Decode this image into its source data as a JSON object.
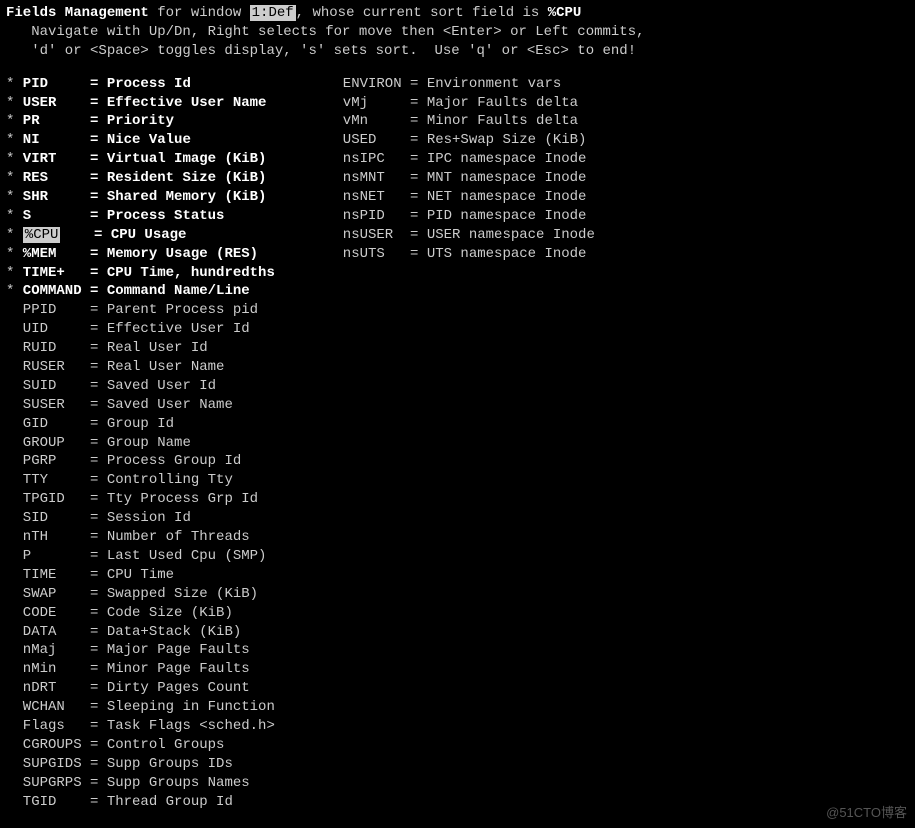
{
  "header": {
    "title": "Fields Management",
    "for_window_label": " for window ",
    "window_name": "1:Def",
    "sort_label": ", whose current sort field is ",
    "sort_field": "%CPU",
    "help1": "Navigate with Up/Dn, Right selects for move then <Enter> or Left commits,",
    "help2": "'d' or <Space> toggles display, 's' sets sort.  Use 'q' or <Esc> to end!"
  },
  "selected": "%CPU",
  "col1": [
    {
      "star": true,
      "name": "PID",
      "desc": "Process Id"
    },
    {
      "star": true,
      "name": "USER",
      "desc": "Effective User Name"
    },
    {
      "star": true,
      "name": "PR",
      "desc": "Priority"
    },
    {
      "star": true,
      "name": "NI",
      "desc": "Nice Value"
    },
    {
      "star": true,
      "name": "VIRT",
      "desc": "Virtual Image (KiB)"
    },
    {
      "star": true,
      "name": "RES",
      "desc": "Resident Size (KiB)"
    },
    {
      "star": true,
      "name": "SHR",
      "desc": "Shared Memory (KiB)"
    },
    {
      "star": true,
      "name": "S",
      "desc": "Process Status"
    },
    {
      "star": true,
      "name": "%CPU",
      "desc": "CPU Usage"
    },
    {
      "star": true,
      "name": "%MEM",
      "desc": "Memory Usage (RES)"
    },
    {
      "star": true,
      "name": "TIME+",
      "desc": "CPU Time, hundredths"
    },
    {
      "star": true,
      "name": "COMMAND",
      "desc": "Command Name/Line"
    },
    {
      "star": false,
      "name": "PPID",
      "desc": "Parent Process pid"
    },
    {
      "star": false,
      "name": "UID",
      "desc": "Effective User Id"
    },
    {
      "star": false,
      "name": "RUID",
      "desc": "Real User Id"
    },
    {
      "star": false,
      "name": "RUSER",
      "desc": "Real User Name"
    },
    {
      "star": false,
      "name": "SUID",
      "desc": "Saved User Id"
    },
    {
      "star": false,
      "name": "SUSER",
      "desc": "Saved User Name"
    },
    {
      "star": false,
      "name": "GID",
      "desc": "Group Id"
    },
    {
      "star": false,
      "name": "GROUP",
      "desc": "Group Name"
    },
    {
      "star": false,
      "name": "PGRP",
      "desc": "Process Group Id"
    },
    {
      "star": false,
      "name": "TTY",
      "desc": "Controlling Tty"
    },
    {
      "star": false,
      "name": "TPGID",
      "desc": "Tty Process Grp Id"
    },
    {
      "star": false,
      "name": "SID",
      "desc": "Session Id"
    },
    {
      "star": false,
      "name": "nTH",
      "desc": "Number of Threads"
    },
    {
      "star": false,
      "name": "P",
      "desc": "Last Used Cpu (SMP)"
    },
    {
      "star": false,
      "name": "TIME",
      "desc": "CPU Time"
    },
    {
      "star": false,
      "name": "SWAP",
      "desc": "Swapped Size (KiB)"
    },
    {
      "star": false,
      "name": "CODE",
      "desc": "Code Size (KiB)"
    },
    {
      "star": false,
      "name": "DATA",
      "desc": "Data+Stack (KiB)"
    },
    {
      "star": false,
      "name": "nMaj",
      "desc": "Major Page Faults"
    },
    {
      "star": false,
      "name": "nMin",
      "desc": "Minor Page Faults"
    },
    {
      "star": false,
      "name": "nDRT",
      "desc": "Dirty Pages Count"
    },
    {
      "star": false,
      "name": "WCHAN",
      "desc": "Sleeping in Function"
    },
    {
      "star": false,
      "name": "Flags",
      "desc": "Task Flags <sched.h>"
    },
    {
      "star": false,
      "name": "CGROUPS",
      "desc": "Control Groups"
    },
    {
      "star": false,
      "name": "SUPGIDS",
      "desc": "Supp Groups IDs"
    },
    {
      "star": false,
      "name": "SUPGRPS",
      "desc": "Supp Groups Names"
    },
    {
      "star": false,
      "name": "TGID",
      "desc": "Thread Group Id"
    }
  ],
  "col2": [
    {
      "name": "ENVIRON",
      "desc": "Environment vars"
    },
    {
      "name": "vMj",
      "desc": "Major Faults delta"
    },
    {
      "name": "vMn",
      "desc": "Minor Faults delta"
    },
    {
      "name": "USED",
      "desc": "Res+Swap Size (KiB)"
    },
    {
      "name": "nsIPC",
      "desc": "IPC namespace Inode"
    },
    {
      "name": "nsMNT",
      "desc": "MNT namespace Inode"
    },
    {
      "name": "nsNET",
      "desc": "NET namespace Inode"
    },
    {
      "name": "nsPID",
      "desc": "PID namespace Inode"
    },
    {
      "name": "nsUSER",
      "desc": "USER namespace Inode"
    },
    {
      "name": "nsUTS",
      "desc": "UTS namespace Inode"
    }
  ],
  "watermark": "@51CTO博客"
}
